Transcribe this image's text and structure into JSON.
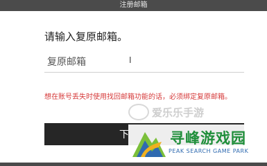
{
  "window": {
    "title": "注册邮箱"
  },
  "dialog": {
    "heading": "请输入复原邮箱。",
    "email_input": {
      "placeholder": "复原邮箱",
      "value": ""
    },
    "hint": "想在账号丢失时使用找回邮箱功能的话，必须绑定复原邮箱。",
    "next_button_label": "下"
  },
  "watermarks": {
    "top_text": "爱乐乐手游",
    "brand": "寻峰游戏园",
    "tagline": "PEAK SEARCH GAME PARK"
  }
}
